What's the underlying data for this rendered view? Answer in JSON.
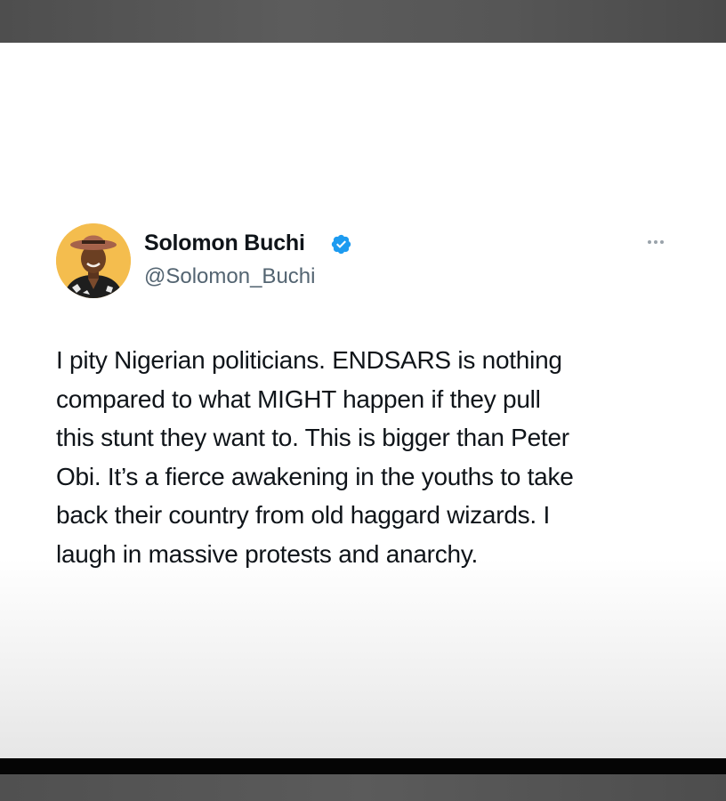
{
  "author": {
    "display_name": "Solomon Buchi",
    "handle": "@Solomon_Buchi",
    "verified_icon": "verified-badge-icon",
    "avatar_icon": "profile-photo"
  },
  "tweet": {
    "lines": [
      "I pity Nigerian politicians.  ENDSARS is nothing",
      "compared to what MIGHT happen if they pull",
      "this stunt they want to. This is bigger than Peter",
      "Obi. It’s a fierce awakening in the youths to take",
      "back their country from old haggard wizards. I",
      "laugh in massive protests and anarchy."
    ]
  },
  "menu": {
    "icon": "more-options-icon"
  },
  "colors": {
    "name": "#0f1419",
    "handle": "#536471",
    "verified": "#1d9bf0",
    "frame": "#5a5a5a",
    "background": "#ffffff"
  }
}
